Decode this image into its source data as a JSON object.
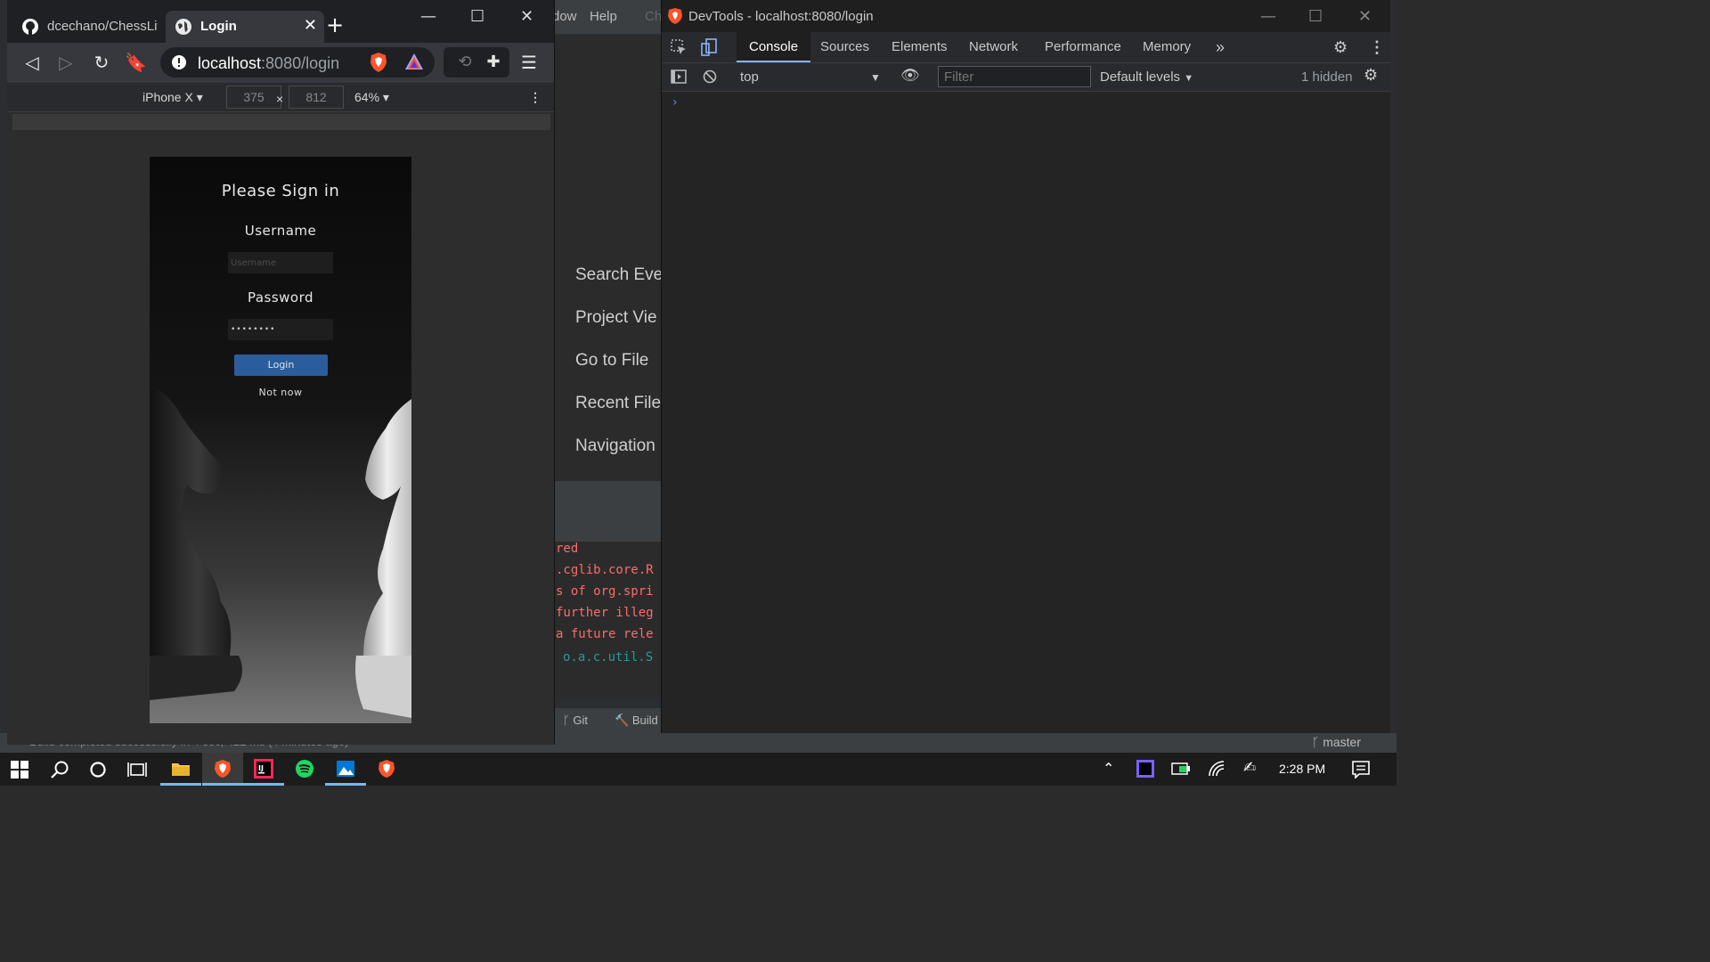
{
  "ide": {
    "menu_window": "dow",
    "menu_help": "Help",
    "menu_partial": "Ch",
    "welcome_items": [
      "Search Eve",
      "Project Vie",
      "Go to File",
      "Recent File",
      "Navigation"
    ],
    "log_lines": [
      {
        "text": "red",
        "color": "#ff6b68"
      },
      {
        "text": ".cglib.core.R",
        "color": "#ff6b68"
      },
      {
        "text": "s of org.spri",
        "color": "#ff6b68"
      },
      {
        "text": "further illeg",
        "color": "#ff6b68"
      },
      {
        "text": "a future rele",
        "color": "#ff6b68"
      },
      {
        "text": "o.a.c.util.S",
        "color": "#299999"
      }
    ],
    "bottom_tabs": {
      "git": "Git",
      "build": "Build"
    },
    "status_text": "Build completed successfully in 4 sec, 422 ms (4 minutes ago)",
    "git_branch": "master"
  },
  "browser": {
    "tabs": [
      {
        "label": "dcechano/ChessLiv",
        "icon": "github-icon"
      },
      {
        "label": "Login",
        "icon": "globe-icon"
      }
    ],
    "url_host": "localhost",
    "url_rest": ":8080/login",
    "device": {
      "name": "iPhone X",
      "width": "375",
      "height": "812",
      "separator": "×",
      "zoom": "64%"
    }
  },
  "page": {
    "title": "Please Sign in",
    "username_label": "Username",
    "username_placeholder": "Username",
    "password_label": "Password",
    "password_value": "••••••••",
    "login_button": "Login",
    "not_now": "Not now"
  },
  "devtools": {
    "title": "DevTools - localhost:8080/login",
    "tabs": [
      "Console",
      "Sources",
      "Elements",
      "Network",
      "Performance",
      "Memory"
    ],
    "more_tabs": "»",
    "context": "top",
    "filter_placeholder": "Filter",
    "levels": "Default levels",
    "hidden": "1 hidden",
    "prompt": "›"
  },
  "taskbar": {
    "time": "2:28 PM",
    "accent": "#76b9ed"
  }
}
